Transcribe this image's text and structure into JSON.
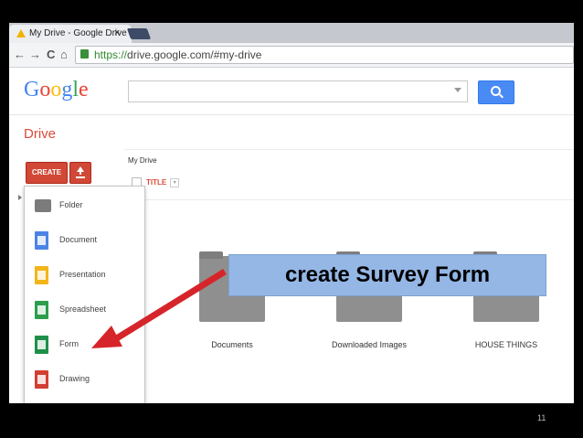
{
  "browser": {
    "tab_title": "My Drive - Google Drive",
    "tab_close": "×",
    "url_scheme": "https://",
    "url_rest": "drive.google.com/#my-drive",
    "back": "←",
    "forward": "→",
    "reload": "C",
    "home": "⌂"
  },
  "google_logo": {
    "letters": [
      "G",
      "o",
      "o",
      "g",
      "l",
      "e"
    ],
    "colors": [
      "#4285f4",
      "#ea4335",
      "#fbbc05",
      "#4285f4",
      "#34a853",
      "#ea4335"
    ]
  },
  "drive": {
    "label": "Drive",
    "breadcrumb": "My Drive",
    "create_label": "CREATE",
    "title_header": "TITLE",
    "title_dropdown": "▾"
  },
  "create_menu": {
    "items": [
      {
        "label": "Folder",
        "icon": "folder-icon"
      },
      {
        "label": "Document",
        "icon": "document-icon"
      },
      {
        "label": "Presentation",
        "icon": "presentation-icon"
      },
      {
        "label": "Spreadsheet",
        "icon": "spreadsheet-icon"
      },
      {
        "label": "Form",
        "icon": "form-icon"
      },
      {
        "label": "Drawing",
        "icon": "drawing-icon"
      }
    ]
  },
  "folders": [
    {
      "name": "Documents"
    },
    {
      "name": "Downloaded Images"
    },
    {
      "name": "HOUSE THINGS"
    }
  ],
  "annotation": {
    "text": "create Survey Form",
    "arrow_color": "#d6252a"
  },
  "slide_number": "11"
}
